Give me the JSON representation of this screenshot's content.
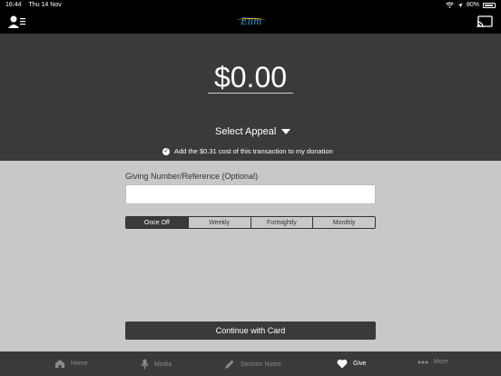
{
  "status_bar": {
    "time": "16:44",
    "date": "Thu 14 Nov",
    "battery": "80%"
  },
  "nav": {
    "logo_text": "Elim",
    "profile_icon": "profile-menu-icon",
    "cast_icon": "cast-icon"
  },
  "donation": {
    "amount": "$0.00",
    "select_appeal": "Select Appeal",
    "fee_note": "Add the $0.31 cost of this transaction to my donation"
  },
  "form": {
    "reference_label": "Giving Number/Reference (Optional)",
    "reference_value": "",
    "frequency_options": [
      "Once Off",
      "Weekly",
      "Fortnightly",
      "Monthly"
    ],
    "frequency_selected": "Once Off",
    "continue_label": "Continue with Card"
  },
  "tabs": [
    {
      "label": "Home",
      "icon": "home-icon"
    },
    {
      "label": "Media",
      "icon": "microphone-icon"
    },
    {
      "label": "Sermon Notes",
      "icon": "pencil-icon"
    },
    {
      "label": "Give",
      "icon": "heart-icon",
      "active": true
    },
    {
      "label": "More",
      "icon": "more-dots-icon"
    }
  ],
  "colors": {
    "dark_panel": "#3a3a3a",
    "light_panel": "#c8c8c8",
    "logo_blue": "#2fa7e0",
    "logo_gold": "#f2b632"
  }
}
